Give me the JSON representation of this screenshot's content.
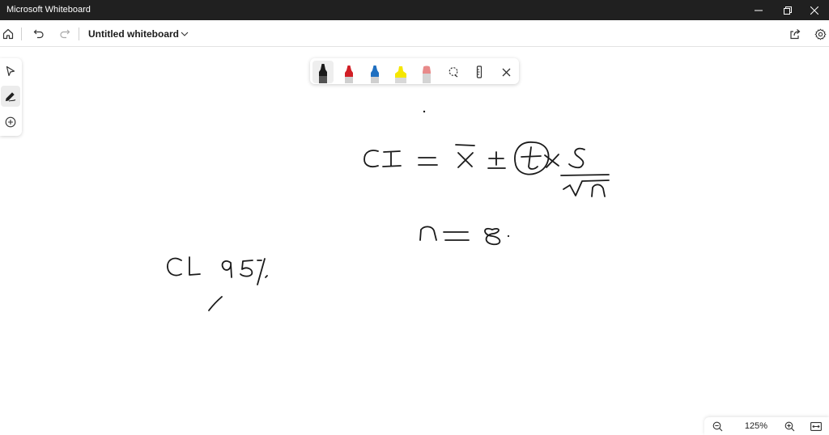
{
  "window": {
    "app_title": "Microsoft Whiteboard",
    "controls": [
      "minimize-icon",
      "restore-icon",
      "close-icon"
    ]
  },
  "appbar": {
    "document_title": "Untitled whiteboard",
    "left_icons": [
      "home-icon",
      "undo-icon",
      "redo-icon",
      "chevron-down-icon"
    ],
    "right_icons": [
      "share-icon",
      "gear-icon"
    ]
  },
  "toolbox": {
    "tools": [
      "select-cursor-icon",
      "pen-icon",
      "add-icon"
    ],
    "active_tool": "pen-icon"
  },
  "ink_toolbar": {
    "pens": [
      {
        "name": "black-pen",
        "color": "#1a1a1a",
        "selected": true
      },
      {
        "name": "red-pen",
        "color": "#d11f26",
        "selected": false
      },
      {
        "name": "blue-pen",
        "color": "#1f6fc0",
        "selected": false
      },
      {
        "name": "yellow-highlighter",
        "color": "#f5e600",
        "selected": false
      },
      {
        "name": "eraser",
        "color": "#e88a8a",
        "selected": false
      }
    ],
    "tools": [
      "lasso-icon",
      "ruler-icon",
      "close-icon"
    ]
  },
  "canvas": {
    "formula": "CI = x̄ ± t × s / √n",
    "sample_size": "n = 8.",
    "confidence_level": "CL 95%"
  },
  "zoom": {
    "level": "125%",
    "icons": [
      "zoom-out-icon",
      "zoom-in-icon",
      "fit-to-screen-icon"
    ]
  }
}
